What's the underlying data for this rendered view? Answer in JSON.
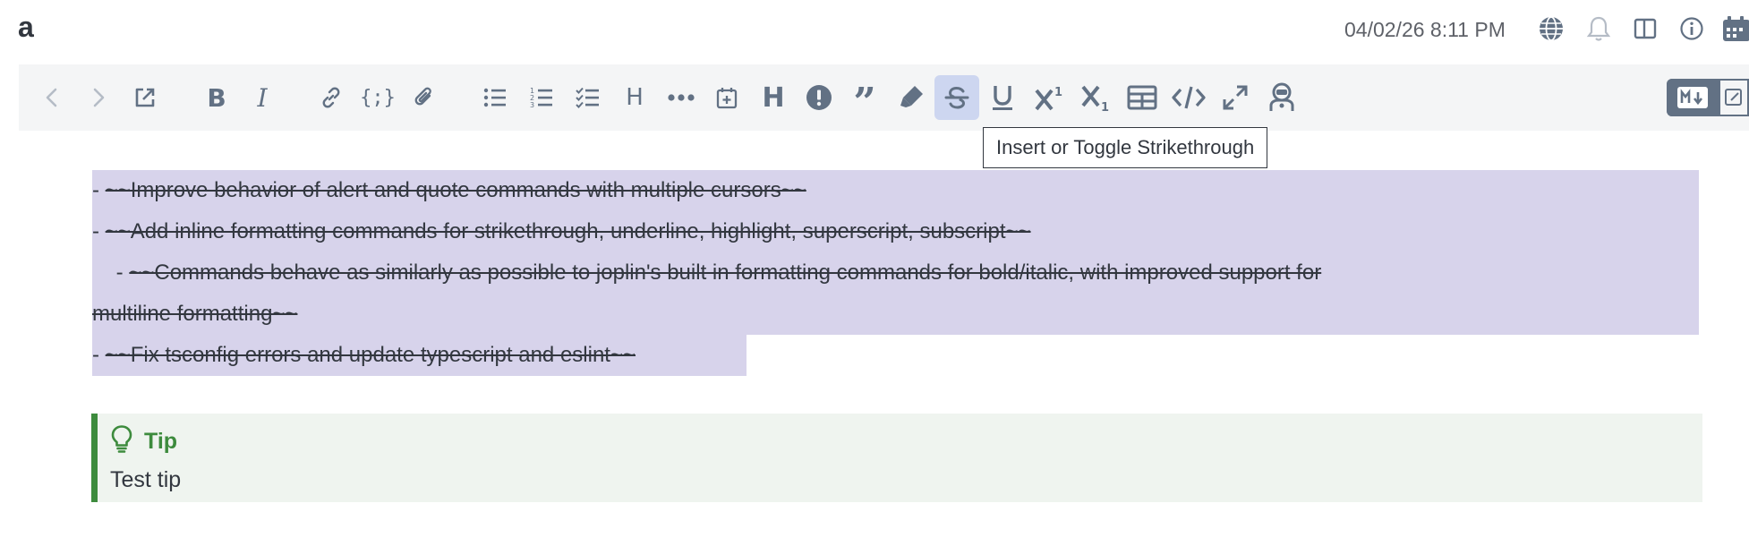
{
  "header": {
    "title": "a",
    "datetime": "04/02/26 8:11 PM",
    "icons": [
      "globe-icon",
      "bell-icon",
      "layout-columns-icon",
      "info-icon",
      "calendar-icon"
    ]
  },
  "toolbar": {
    "buttons": [
      {
        "name": "back-button",
        "icon": "chevron-left",
        "state": "disabled"
      },
      {
        "name": "forward-button",
        "icon": "chevron-right",
        "state": "disabled"
      },
      {
        "name": "open-external-button",
        "icon": "external-link"
      },
      {
        "name": "bold-button",
        "icon": "bold"
      },
      {
        "name": "italic-button",
        "icon": "italic"
      },
      {
        "name": "link-button",
        "icon": "link"
      },
      {
        "name": "code-button",
        "icon": "code-braces"
      },
      {
        "name": "attach-button",
        "icon": "paperclip"
      },
      {
        "name": "bullet-list-button",
        "icon": "list-bullets"
      },
      {
        "name": "numbered-list-button",
        "icon": "list-numbers"
      },
      {
        "name": "checklist-button",
        "icon": "list-check"
      },
      {
        "name": "heading-button",
        "icon": "heading"
      },
      {
        "name": "horizontal-rule-button",
        "icon": "ellipsis"
      },
      {
        "name": "insert-date-button",
        "icon": "calendar-plus"
      },
      {
        "name": "heading-bold-button",
        "icon": "heading-bold"
      },
      {
        "name": "alert-button",
        "icon": "exclamation-circle"
      },
      {
        "name": "quote-button",
        "icon": "quote"
      },
      {
        "name": "highlight-button",
        "icon": "highlighter"
      },
      {
        "name": "strikethrough-button",
        "icon": "strikethrough",
        "state": "active"
      },
      {
        "name": "underline-button",
        "icon": "underline"
      },
      {
        "name": "superscript-button",
        "icon": "superscript"
      },
      {
        "name": "subscript-button",
        "icon": "subscript"
      },
      {
        "name": "table-button",
        "icon": "table"
      },
      {
        "name": "code-block-button",
        "icon": "code"
      },
      {
        "name": "fullscreen-button",
        "icon": "expand"
      },
      {
        "name": "plugin-button",
        "icon": "robot"
      }
    ],
    "tooltip": "Insert or Toggle Strikethrough",
    "markdown_toggle_icon": "markdown-icon"
  },
  "editor": {
    "lines": [
      {
        "prefix": "- ",
        "text": "~~Improve behavior of alert and quote commands with multiple cursors~~"
      },
      {
        "prefix": "- ",
        "text": "~~Add inline formatting commands for strikethrough, underline, highlight, superscript, subscript~~"
      },
      {
        "prefix": "    - ",
        "text": "~~Commands behave as similarly as possible to joplin's built in formatting commands for bold/italic, with improved support for"
      },
      {
        "prefix": "",
        "text": "multiline formatting~~"
      },
      {
        "prefix": "- ",
        "text": "~~Fix tsconfig errors and update typescript and eslint~~"
      }
    ],
    "tip": {
      "label": "Tip",
      "body": "Test tip",
      "icon": "lightbulb-icon",
      "color": "#3d8b3d"
    },
    "selection_color": "#d7d3eb"
  }
}
